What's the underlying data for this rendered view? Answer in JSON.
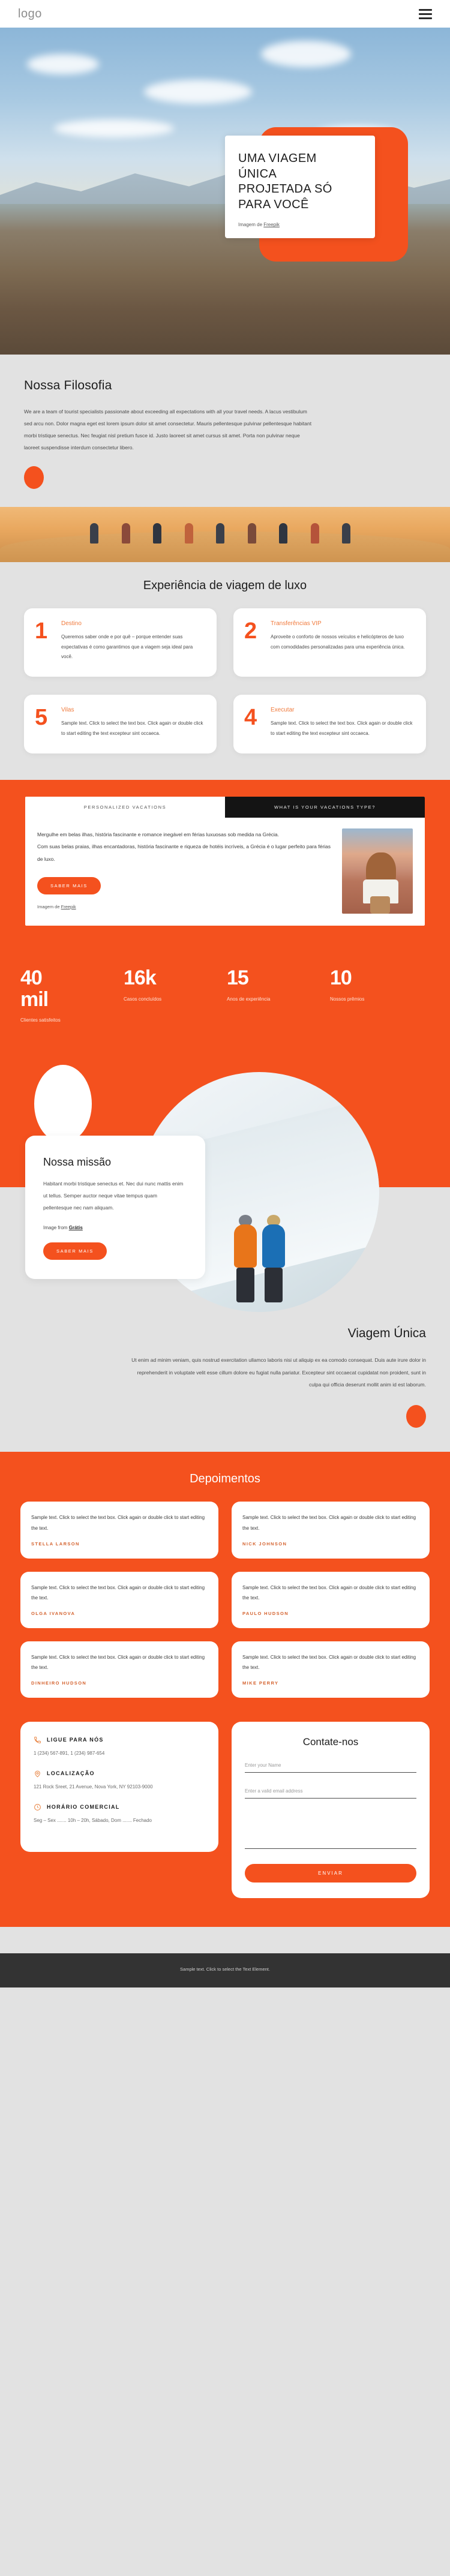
{
  "header": {
    "logo": "logo",
    "menu_icon": "hamburger-menu-icon"
  },
  "hero": {
    "title_lines": [
      "UMA VIAGEM",
      "ÚNICA",
      "PROJETADA SÓ",
      "PARA VOCÊ"
    ],
    "credit_prefix": "Imagem de ",
    "credit_link": "Freepik"
  },
  "philosophy": {
    "heading": "Nossa Filosofia",
    "body": "We are a team of tourist specialists passionate about exceeding all expectations with all your travel needs. A lacus vestibulum sed arcu non. Dolor magna eget est lorem ipsum dolor sit amet consectetur. Mauris pellentesque pulvinar pellentesque habitant morbi tristique senectus. Nec feugiat nisl pretium fusce id. Justo laoreet sit amet cursus sit amet. Porta non pulvinar neque laoreet suspendisse interdum consectetur libero."
  },
  "luxury": {
    "heading": "Experiência de viagem de luxo",
    "cards": [
      {
        "number": "1",
        "title": "Destino",
        "text": "Queremos saber onde e por quê – porque entender suas expectativas é como garantimos que a viagem seja ideal para você."
      },
      {
        "number": "2",
        "title": "Transferências VIP",
        "text": "Aproveite o conforto de nossos veículos e helicópteros de luxo com comodidades personalizadas para uma experiência única."
      },
      {
        "number": "5",
        "title": "Vilas",
        "text": "Sample text. Click to select the text box. Click again or double click to start editing the text excepteur sint occaeca."
      },
      {
        "number": "4",
        "title": "Executar",
        "text": "Sample text. Click to select the text box. Click again or double click to start editing the text excepteur sint occaeca."
      }
    ]
  },
  "vacations": {
    "tabs": [
      {
        "label": "PERSONALIZED VACATIONS",
        "active": true
      },
      {
        "label": "WHAT IS YOUR VACATIONS TYPE?",
        "active": false
      }
    ],
    "paragraph1": "Mergulhe em belas ilhas, história fascinante e romance inegável em férias luxuosas sob medida na Grécia.",
    "paragraph2": "Com suas belas praias, ilhas encantadoras, história fascinante e riqueza de hotéis incríveis, a Grécia é o lugar perfeito para férias de luxo.",
    "button": "SABER MAIS",
    "credit_prefix": "Imagem de ",
    "credit_link": "Freepik"
  },
  "stats": [
    {
      "value": "40 mil",
      "label": "Clientes satisfeitos"
    },
    {
      "value": "16k",
      "label": "Casos concluídos"
    },
    {
      "value": "15",
      "label": "Anos de experiência"
    },
    {
      "value": "10",
      "label": "Nossos prêmios"
    }
  ],
  "mission": {
    "heading": "Nossa missão",
    "body": "Habitant morbi tristique senectus et. Nec dui nunc mattis enim ut tellus. Semper auctor neque vitae tempus quam pellentesque nec nam aliquam.",
    "credit_prefix": "Image from ",
    "credit_link": "Grátis",
    "button": "SABER MAIS"
  },
  "unique": {
    "heading": "Viagem Única",
    "body": "Ut enim ad minim veniam, quis nostrud exercitation ullamco laboris nisi ut aliquip ex ea comodo consequat. Duis aute irure dolor in reprehenderit in voluptate velit esse cillum dolore eu fugiat nulla pariatur. Excepteur sint occaecat cupidatat non proident, sunt in culpa qui officia deserunt mollit anim id est laborum."
  },
  "testimonials": {
    "heading": "Depoimentos",
    "items": [
      {
        "text": "Sample text. Click to select the text box. Click again or double click to start editing the text.",
        "name": "STELLA LARSON"
      },
      {
        "text": "Sample text. Click to select the text box. Click again or double click to start editing the text.",
        "name": "NICK JOHNSON"
      },
      {
        "text": "Sample text. Click to select the text box. Click again or double click to start editing the text.",
        "name": "OLGA IVANOVA"
      },
      {
        "text": "Sample text. Click to select the text box. Click again or double click to start editing the text.",
        "name": "PAULO HUDSON"
      },
      {
        "text": "Sample text. Click to select the text box. Click again or double click to start editing the text.",
        "name": "DINHEIRO HUDSON"
      },
      {
        "text": "Sample text. Click to select the text box. Click again or double click to start editing the text.",
        "name": "MIKE PERRY"
      }
    ]
  },
  "contact": {
    "phone_title": "LIGUE PARA NÓS",
    "phone_value": "1 (234) 567-891, 1 (234) 987-654",
    "location_title": "LOCALIZAÇÃO",
    "location_value": "121 Rock Sreet, 21 Avenue, Nova York, NY 92103-9000",
    "hours_title": "HORÁRIO COMERCIAL",
    "hours_value": "Seg – Sex ....... 10h – 20h, Sábado, Dom ....... Fechado",
    "form_heading": "Contate-nos",
    "name_placeholder": "Enter your Name",
    "email_placeholder": "Enter a valid email address",
    "message_placeholder": "",
    "submit_label": "ENVIAR"
  },
  "footer": {
    "text": "Sample text. Click to select the Text Element."
  },
  "colors": {
    "accent": "#f4511e",
    "page_bg": "#e2e2e2",
    "footer_bg": "#333333",
    "dark_tab": "#141414"
  }
}
